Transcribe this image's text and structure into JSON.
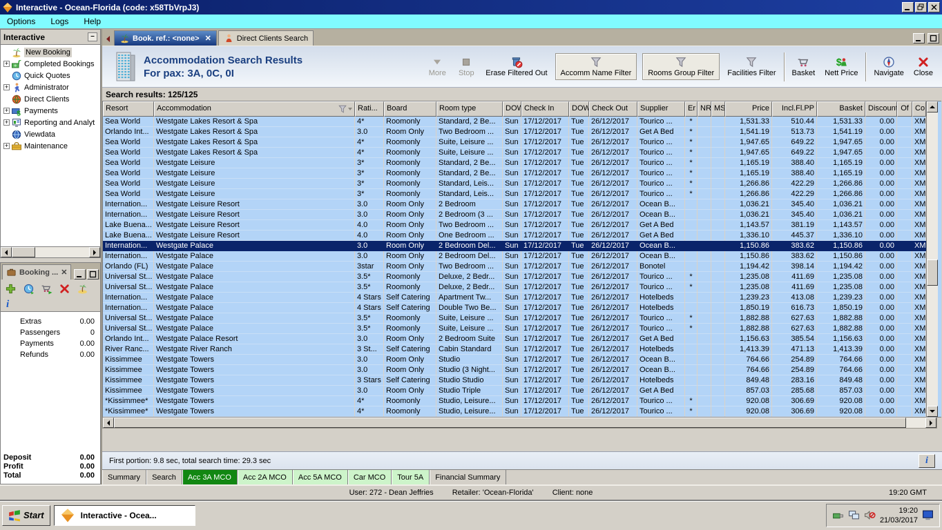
{
  "window": {
    "title": "Interactive - Ocean-Florida (code: x58TbVrpJ3)"
  },
  "menu": {
    "items": [
      "Options",
      "Logs",
      "Help"
    ]
  },
  "sidebar": {
    "title": "Interactive",
    "items": [
      {
        "label": "New Booking",
        "icon": "palm-tree-icon",
        "expandable": false,
        "selected": true
      },
      {
        "label": "Completed Bookings",
        "icon": "bookings-icon",
        "expandable": true,
        "selected": false
      },
      {
        "label": "Quick Quotes",
        "icon": "clock-icon",
        "expandable": false,
        "selected": false
      },
      {
        "label": "Administrator",
        "icon": "admin-icon",
        "expandable": true,
        "selected": false
      },
      {
        "label": "Direct Clients",
        "icon": "clients-globe-icon",
        "expandable": false,
        "selected": false
      },
      {
        "label": "Payments",
        "icon": "payments-icon",
        "expandable": true,
        "selected": false
      },
      {
        "label": "Reporting and Analyt",
        "icon": "reporting-icon",
        "expandable": true,
        "selected": false
      },
      {
        "label": "Viewdata",
        "icon": "viewdata-icon",
        "expandable": false,
        "selected": false
      },
      {
        "label": "Maintenance",
        "icon": "maintenance-icon",
        "expandable": true,
        "selected": false
      }
    ]
  },
  "booking_panel": {
    "tab_label": "Booking ...",
    "toolbar_icons": [
      "add-icon",
      "quote-clock-icon",
      "cart-go-icon",
      "delete-x-icon",
      "island-icon"
    ],
    "info_glyph": "i",
    "rows": [
      {
        "label": "Extras",
        "value": "0.00"
      },
      {
        "label": "Passengers",
        "value": "0"
      },
      {
        "label": "Payments",
        "value": "0.00"
      },
      {
        "label": "Refunds",
        "value": "0.00"
      }
    ],
    "totals": [
      {
        "label": "Deposit",
        "value": "0.00"
      },
      {
        "label": "Profit",
        "value": "0.00"
      },
      {
        "label": "Total",
        "value": "0.00"
      }
    ]
  },
  "doc_tabs": [
    {
      "label": "Book. ref.: <none>",
      "icon": "palm-tree-icon",
      "active": true,
      "closable": true
    },
    {
      "label": "Direct Clients Search",
      "icon": "person-icon",
      "active": false,
      "closable": false
    }
  ],
  "header": {
    "title": "Accommodation Search Results",
    "subtitle": "For pax: 3A, 0C, 0I"
  },
  "toolbar": {
    "buttons": [
      {
        "label": "More",
        "icon": "more-icon",
        "disabled": true
      },
      {
        "label": "Stop",
        "icon": "stop-icon",
        "disabled": true
      },
      {
        "label": "Erase Filtered Out",
        "icon": "erase-filter-icon"
      },
      {
        "label": "Accomm Name Filter",
        "icon": "funnel-icon",
        "framed": true
      },
      {
        "label": "Rooms Group Filter",
        "icon": "funnel-icon",
        "framed": true
      },
      {
        "label": "Facilities Filter",
        "icon": "funnel-icon"
      },
      {
        "sep": true
      },
      {
        "label": "Basket",
        "icon": "basket-icon"
      },
      {
        "label": "Nett Price",
        "icon": "nett-price-icon"
      },
      {
        "sep": true
      },
      {
        "label": "Navigate",
        "icon": "navigate-icon"
      },
      {
        "label": "Close",
        "icon": "close-icon"
      }
    ]
  },
  "search_results_label": "Search results: 125/125",
  "table": {
    "columns": [
      "Resort",
      "Accommodation",
      "Rati...",
      "Board",
      "Room type",
      "DOW",
      "Check In",
      "DOW",
      "Check Out",
      "Supplier",
      "Er",
      "NR",
      "MS",
      "Price",
      "Incl.Fl.PP",
      "Basket",
      "Discount",
      "Of",
      "Co"
    ],
    "selected_row_index": 12,
    "rows": [
      [
        "Sea World",
        "Westgate Lakes Resort & Spa",
        "4*",
        "Roomonly",
        "Standard, 2 Be...",
        "Sun",
        "17/12/2017",
        "Tue",
        "26/12/2017",
        "Tourico ...",
        "*",
        "",
        "",
        "1,531.33",
        "510.44",
        "1,531.33",
        "0.00",
        "",
        "XM"
      ],
      [
        "Orlando Int...",
        "Westgate Lakes Resort & Spa",
        "3.0",
        "Room Only",
        "Two Bedroom ...",
        "Sun",
        "17/12/2017",
        "Tue",
        "26/12/2017",
        "Get A Bed",
        "*",
        "",
        "",
        "1,541.19",
        "513.73",
        "1,541.19",
        "0.00",
        "",
        "XM"
      ],
      [
        "Sea World",
        "Westgate Lakes Resort & Spa",
        "4*",
        "Roomonly",
        "Suite, Leisure ...",
        "Sun",
        "17/12/2017",
        "Tue",
        "26/12/2017",
        "Tourico ...",
        "*",
        "",
        "",
        "1,947.65",
        "649.22",
        "1,947.65",
        "0.00",
        "",
        "XM"
      ],
      [
        "Sea World",
        "Westgate Lakes Resort & Spa",
        "4*",
        "Roomonly",
        "Suite, Leisure ...",
        "Sun",
        "17/12/2017",
        "Tue",
        "26/12/2017",
        "Tourico ...",
        "*",
        "",
        "",
        "1,947.65",
        "649.22",
        "1,947.65",
        "0.00",
        "",
        "XM"
      ],
      [
        "Sea World",
        "Westgate Leisure",
        "3*",
        "Roomonly",
        "Standard, 2 Be...",
        "Sun",
        "17/12/2017",
        "Tue",
        "26/12/2017",
        "Tourico ...",
        "*",
        "",
        "",
        "1,165.19",
        "388.40",
        "1,165.19",
        "0.00",
        "",
        "XM"
      ],
      [
        "Sea World",
        "Westgate Leisure",
        "3*",
        "Roomonly",
        "Standard, 2 Be...",
        "Sun",
        "17/12/2017",
        "Tue",
        "26/12/2017",
        "Tourico ...",
        "*",
        "",
        "",
        "1,165.19",
        "388.40",
        "1,165.19",
        "0.00",
        "",
        "XM"
      ],
      [
        "Sea World",
        "Westgate Leisure",
        "3*",
        "Roomonly",
        "Standard, Leis...",
        "Sun",
        "17/12/2017",
        "Tue",
        "26/12/2017",
        "Tourico ...",
        "*",
        "",
        "",
        "1,266.86",
        "422.29",
        "1,266.86",
        "0.00",
        "",
        "XM"
      ],
      [
        "Sea World",
        "Westgate Leisure",
        "3*",
        "Roomonly",
        "Standard, Leis...",
        "Sun",
        "17/12/2017",
        "Tue",
        "26/12/2017",
        "Tourico ...",
        "*",
        "",
        "",
        "1,266.86",
        "422.29",
        "1,266.86",
        "0.00",
        "",
        "XM"
      ],
      [
        "Internation...",
        "Westgate Leisure Resort",
        "3.0",
        "Room Only",
        "2 Bedroom",
        "Sun",
        "17/12/2017",
        "Tue",
        "26/12/2017",
        "Ocean B...",
        "",
        "",
        "",
        "1,036.21",
        "345.40",
        "1,036.21",
        "0.00",
        "",
        "XM"
      ],
      [
        "Internation...",
        "Westgate Leisure Resort",
        "3.0",
        "Room Only",
        "2 Bedroom (3 ...",
        "Sun",
        "17/12/2017",
        "Tue",
        "26/12/2017",
        "Ocean B...",
        "",
        "",
        "",
        "1,036.21",
        "345.40",
        "1,036.21",
        "0.00",
        "",
        "XM"
      ],
      [
        "Lake Buena...",
        "Westgate Leisure Resort",
        "4.0",
        "Room Only",
        "Two Bedroom ...",
        "Sun",
        "17/12/2017",
        "Tue",
        "26/12/2017",
        "Get A Bed",
        "",
        "",
        "",
        "1,143.57",
        "381.19",
        "1,143.57",
        "0.00",
        "",
        "XM"
      ],
      [
        "Lake Buena...",
        "Westgate Leisure Resort",
        "4.0",
        "Room Only",
        "One Bedroom ...",
        "Sun",
        "17/12/2017",
        "Tue",
        "26/12/2017",
        "Get A Bed",
        "",
        "",
        "",
        "1,336.10",
        "445.37",
        "1,336.10",
        "0.00",
        "",
        "XM"
      ],
      [
        "Internation...",
        "Westgate Palace",
        "3.0",
        "Room Only",
        "2 Bedroom Del...",
        "Sun",
        "17/12/2017",
        "Tue",
        "26/12/2017",
        "Ocean B...",
        "",
        "",
        "",
        "1,150.86",
        "383.62",
        "1,150.86",
        "0.00",
        "",
        "XM"
      ],
      [
        "Internation...",
        "Westgate Palace",
        "3.0",
        "Room Only",
        "2 Bedroom Del...",
        "Sun",
        "17/12/2017",
        "Tue",
        "26/12/2017",
        "Ocean B...",
        "",
        "",
        "",
        "1,150.86",
        "383.62",
        "1,150.86",
        "0.00",
        "",
        "XM"
      ],
      [
        "Orlando (FL)",
        "Westgate Palace",
        "3star",
        "Room Only",
        "Two Bedroom ...",
        "Sun",
        "17/12/2017",
        "Tue",
        "26/12/2017",
        "Bonotel",
        "",
        "",
        "",
        "1,194.42",
        "398.14",
        "1,194.42",
        "0.00",
        "",
        "XM"
      ],
      [
        "Universal St...",
        "Westgate Palace",
        "3.5*",
        "Roomonly",
        "Deluxe, 2 Bedr...",
        "Sun",
        "17/12/2017",
        "Tue",
        "26/12/2017",
        "Tourico ...",
        "*",
        "",
        "",
        "1,235.08",
        "411.69",
        "1,235.08",
        "0.00",
        "",
        "XM"
      ],
      [
        "Universal St...",
        "Westgate Palace",
        "3.5*",
        "Roomonly",
        "Deluxe, 2 Bedr...",
        "Sun",
        "17/12/2017",
        "Tue",
        "26/12/2017",
        "Tourico ...",
        "*",
        "",
        "",
        "1,235.08",
        "411.69",
        "1,235.08",
        "0.00",
        "",
        "XM"
      ],
      [
        "Internation...",
        "Westgate Palace",
        "4 Stars",
        "Self Catering",
        "Apartment Tw...",
        "Sun",
        "17/12/2017",
        "Tue",
        "26/12/2017",
        "Hotelbeds",
        "",
        "",
        "",
        "1,239.23",
        "413.08",
        "1,239.23",
        "0.00",
        "",
        "XM"
      ],
      [
        "Internation...",
        "Westgate Palace",
        "4 Stars",
        "Self Catering",
        "Double Two Be...",
        "Sun",
        "17/12/2017",
        "Tue",
        "26/12/2017",
        "Hotelbeds",
        "",
        "",
        "",
        "1,850.19",
        "616.73",
        "1,850.19",
        "0.00",
        "",
        "XM"
      ],
      [
        "Universal St...",
        "Westgate Palace",
        "3.5*",
        "Roomonly",
        "Suite, Leisure ...",
        "Sun",
        "17/12/2017",
        "Tue",
        "26/12/2017",
        "Tourico ...",
        "*",
        "",
        "",
        "1,882.88",
        "627.63",
        "1,882.88",
        "0.00",
        "",
        "XM"
      ],
      [
        "Universal St...",
        "Westgate Palace",
        "3.5*",
        "Roomonly",
        "Suite, Leisure ...",
        "Sun",
        "17/12/2017",
        "Tue",
        "26/12/2017",
        "Tourico ...",
        "*",
        "",
        "",
        "1,882.88",
        "627.63",
        "1,882.88",
        "0.00",
        "",
        "XM"
      ],
      [
        "Orlando Int...",
        "Westgate Palace Resort",
        "3.0",
        "Room Only",
        "2 Bedroom Suite",
        "Sun",
        "17/12/2017",
        "Tue",
        "26/12/2017",
        "Get A Bed",
        "",
        "",
        "",
        "1,156.63",
        "385.54",
        "1,156.63",
        "0.00",
        "",
        "XM"
      ],
      [
        "River Ranc...",
        "Westgate River Ranch",
        "3 St...",
        "Self Catering",
        "Cabin Standard",
        "Sun",
        "17/12/2017",
        "Tue",
        "26/12/2017",
        "Hotelbeds",
        "",
        "",
        "",
        "1,413.39",
        "471.13",
        "1,413.39",
        "0.00",
        "",
        "XM"
      ],
      [
        "Kissimmee",
        "Westgate Towers",
        "3.0",
        "Room Only",
        "Studio",
        "Sun",
        "17/12/2017",
        "Tue",
        "26/12/2017",
        "Ocean B...",
        "",
        "",
        "",
        "764.66",
        "254.89",
        "764.66",
        "0.00",
        "",
        "XM"
      ],
      [
        "Kissimmee",
        "Westgate Towers",
        "3.0",
        "Room Only",
        "Studio (3 Night...",
        "Sun",
        "17/12/2017",
        "Tue",
        "26/12/2017",
        "Ocean B...",
        "",
        "",
        "",
        "764.66",
        "254.89",
        "764.66",
        "0.00",
        "",
        "XM"
      ],
      [
        "Kissimmee",
        "Westgate Towers",
        "3 Stars",
        "Self Catering",
        "Studio Studio",
        "Sun",
        "17/12/2017",
        "Tue",
        "26/12/2017",
        "Hotelbeds",
        "",
        "",
        "",
        "849.48",
        "283.16",
        "849.48",
        "0.00",
        "",
        "XM"
      ],
      [
        "Kissimmee",
        "Westgate Towers",
        "3.0",
        "Room Only",
        "Studio Triple",
        "Sun",
        "17/12/2017",
        "Tue",
        "26/12/2017",
        "Get A Bed",
        "",
        "",
        "",
        "857.03",
        "285.68",
        "857.03",
        "0.00",
        "",
        "XM"
      ],
      [
        "*Kissimmee*",
        "Westgate Towers",
        "4*",
        "Roomonly",
        "Studio, Leisure...",
        "Sun",
        "17/12/2017",
        "Tue",
        "26/12/2017",
        "Tourico ...",
        "*",
        "",
        "",
        "920.08",
        "306.69",
        "920.08",
        "0.00",
        "",
        "XM"
      ],
      [
        "*Kissimmee*",
        "Westgate Towers",
        "4*",
        "Roomonly",
        "Studio, Leisure...",
        "Sun",
        "17/12/2017",
        "Tue",
        "26/12/2017",
        "Tourico ...",
        "*",
        "",
        "",
        "920.08",
        "306.69",
        "920.08",
        "0.00",
        "",
        "XM"
      ]
    ]
  },
  "info_bar": {
    "text": "First portion: 9.8 sec, total search time: 29.3 sec"
  },
  "bottom_tabs": [
    {
      "label": "Summary",
      "style": "plain"
    },
    {
      "label": "Search",
      "style": "plain"
    },
    {
      "label": "Acc 3A MCO",
      "style": "active-green"
    },
    {
      "label": "Acc 2A MCO",
      "style": "green"
    },
    {
      "label": "Acc 5A MCO",
      "style": "green"
    },
    {
      "label": "Car MCO",
      "style": "green"
    },
    {
      "label": "Tour 5A",
      "style": "green"
    },
    {
      "label": "Financial Summary",
      "style": "plain"
    }
  ],
  "status_bar": {
    "user": "User: 272 - Dean Jeffries",
    "retailer": "Retailer: 'Ocean-Florida'",
    "client": "Client: none",
    "time": "19:20 GMT"
  },
  "taskbar": {
    "start_label": "Start",
    "task_label": "Interactive - Ocea...",
    "tray_time": "19:20",
    "tray_date": "21/03/2017"
  },
  "colors": {
    "titlebar": "#0a1e66",
    "menubar": "#80fbff",
    "row_bg": "#b3d4f7",
    "selected_row": "#0a246a",
    "active_tab_green": "#128712",
    "light_tab_green": "#cdf4ca"
  }
}
